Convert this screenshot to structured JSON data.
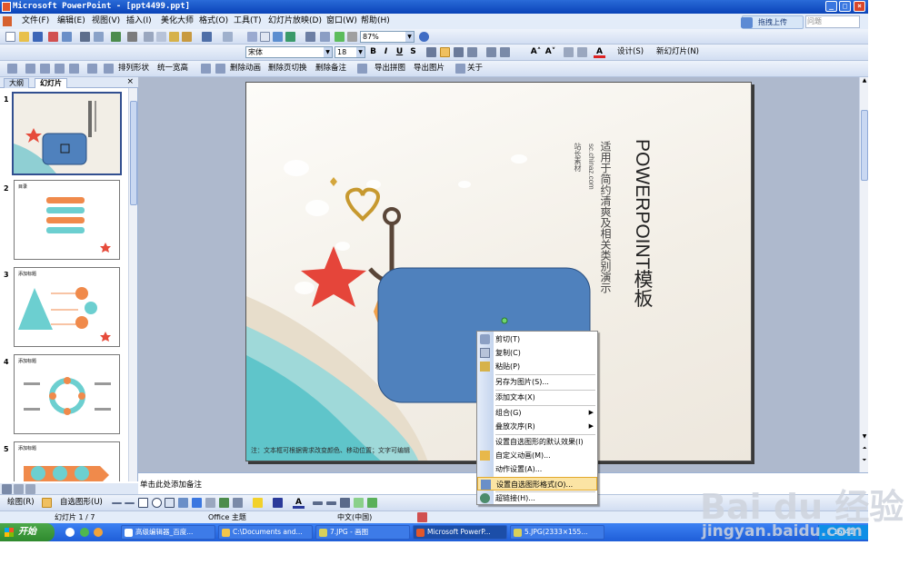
{
  "window": {
    "title": "Microsoft PowerPoint - [ppt4499.ppt]",
    "upload_button": "拖拽上传",
    "help_placeholder": "问题"
  },
  "menu": [
    "文件(F)",
    "编辑(E)",
    "视图(V)",
    "插入(I)",
    "美化大师",
    "格式(O)",
    "工具(T)",
    "幻灯片放映(D)",
    "窗口(W)",
    "帮助(H)"
  ],
  "toolbar": {
    "zoom": "87%",
    "font_name": "宋体",
    "font_size": "18",
    "design_label": "设计(S)",
    "new_slide_label": "新幻灯片(N)",
    "addin_items": [
      "排列形状",
      "统一宽高",
      "删除动画",
      "删除页切换",
      "删除备注",
      "导出拼图",
      "导出图片",
      "关于"
    ]
  },
  "panel": {
    "tabs": [
      "大纲",
      "幻灯片"
    ],
    "close": "×",
    "slide_numbers": [
      "1",
      "2",
      "3",
      "4",
      "5"
    ],
    "thumb_titles": [
      "目录",
      "添加标题",
      "添加标题",
      "添加标题"
    ]
  },
  "slide": {
    "title": "POWERPOINT模板",
    "subtitle": "适用于简约清爽及相关类别演示",
    "site": "sc.chinaz.com",
    "credit": "站长素材",
    "footnote": "注：文本框可根据需求改变颜色、移动位置；文字可编辑",
    "shape_color": "#4f81bd"
  },
  "notes": {
    "placeholder": "单击此处添加备注"
  },
  "drawing_bar": {
    "draw_label": "绘图(R)",
    "autoshape_label": "自选图形(U)"
  },
  "status": {
    "slide_position": "幻灯片 1 / 7",
    "theme": "Office 主题",
    "language": "中文(中国)"
  },
  "context_menu": [
    {
      "label": "剪切(T)",
      "icon": "scissors-icon"
    },
    {
      "label": "复制(C)",
      "icon": "copy-icon"
    },
    {
      "label": "粘贴(P)",
      "icon": "paste-icon"
    },
    {
      "label": "另存为图片(S)...",
      "icon": ""
    },
    {
      "label": "添加文本(X)",
      "icon": ""
    },
    {
      "label": "组合(G)",
      "icon": "",
      "submenu": true
    },
    {
      "label": "叠放次序(R)",
      "icon": "",
      "submenu": true
    },
    {
      "label": "设置自选图形的默认效果(I)",
      "icon": ""
    },
    {
      "label": "自定义动画(M)...",
      "icon": "animation-icon"
    },
    {
      "label": "动作设置(A)...",
      "icon": ""
    },
    {
      "label": "设置自选图形格式(O)...",
      "icon": "format-shape-icon",
      "highlighted": true
    },
    {
      "label": "超链接(H)...",
      "icon": "hyperlink-icon"
    }
  ],
  "taskbar": {
    "start": "开始",
    "tasks": [
      "高级编辑器_百度...",
      "C:\\Documents and...",
      "7.JPG - 画图",
      "Microsoft PowerP...",
      "5.JPG(2333×155..."
    ],
    "time": "16:41"
  },
  "watermark": {
    "brand": "Bai du 经验",
    "url": "jingyan.baidu.com"
  }
}
